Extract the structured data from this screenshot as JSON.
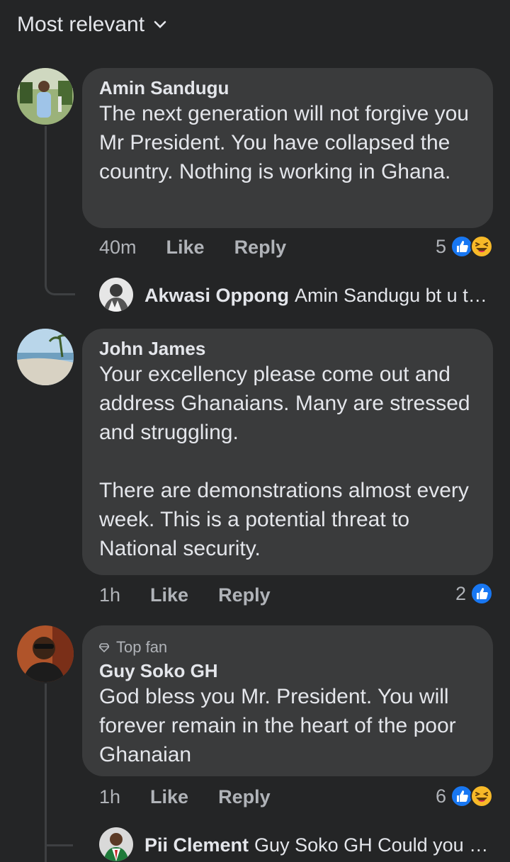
{
  "sort": {
    "label": "Most relevant"
  },
  "comments": [
    {
      "author": "Amin Sandugu",
      "text": "The next generation will not forgive you Mr President. You have collapsed the country. Nothing is working in Ghana.",
      "time": "40m",
      "like": "Like",
      "reply": "Reply",
      "reaction_count": "5",
      "reactions": [
        "like-icon",
        "haha-icon"
      ],
      "reply_preview": {
        "author": "Akwasi Oppong",
        "text": "Amin Sandugu bt u typi..."
      }
    },
    {
      "author": "John James",
      "text": "Your excellency please come out and address Ghanaians. Many are stressed and struggling.\n\nThere are demonstrations almost every week. This is a potential threat to National security.",
      "time": "1h",
      "like": "Like",
      "reply": "Reply",
      "reaction_count": "2",
      "reactions": [
        "like-icon"
      ]
    },
    {
      "badge": "Top fan",
      "author": "Guy Soko GH",
      "text": "God bless you Mr. President. You will forever remain in the heart of the poor Ghanaian",
      "time": "1h",
      "like": "Like",
      "reply": "Reply",
      "reaction_count": "6",
      "reactions": [
        "like-icon",
        "haha-icon"
      ],
      "reply_preview": {
        "author": "Pii Clement",
        "text": "Guy Soko GH  Could you ple..."
      }
    }
  ],
  "colors": {
    "background": "#242526",
    "bubble": "#3a3b3c",
    "like_blue": "#1877f2",
    "haha_yellow": "#f7b928"
  }
}
